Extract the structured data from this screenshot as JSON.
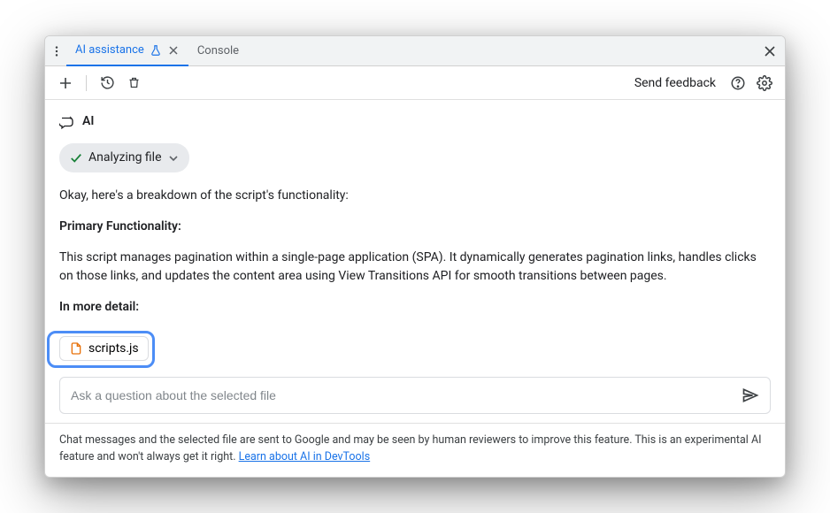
{
  "tabs": {
    "ai_assistance": "AI assistance",
    "console": "Console"
  },
  "toolbar": {
    "feedback": "Send feedback"
  },
  "ai_header": "AI",
  "chip": {
    "label": "Analyzing file"
  },
  "message": {
    "intro": "Okay, here's a breakdown of the script's functionality:",
    "heading1": "Primary Functionality:",
    "body1": "This script manages pagination within a single-page application (SPA). It dynamically generates pagination links, handles clicks on those links, and updates the content area using View Transitions API for smooth transitions between pages.",
    "heading2": "In more detail:"
  },
  "file_chip": {
    "name": "scripts.js"
  },
  "input": {
    "placeholder": "Ask a question about the selected file"
  },
  "disclaimer": {
    "text": "Chat messages and the selected file are sent to Google and may be seen by human reviewers to improve this feature. This is an experimental AI feature and won't always get it right. ",
    "link": "Learn about AI in DevTools"
  }
}
